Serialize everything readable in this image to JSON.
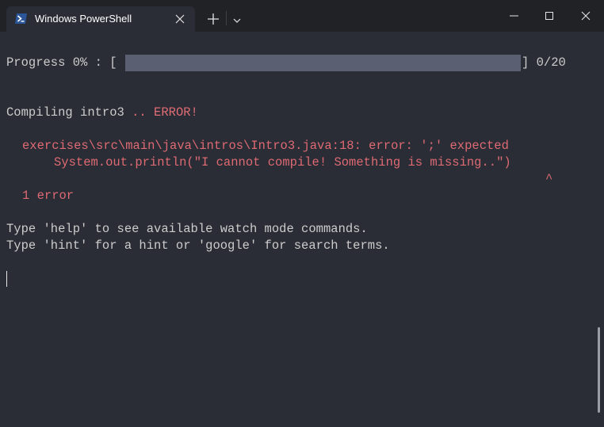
{
  "titlebar": {
    "tab_title": "Windows PowerShell",
    "tab_icon": "powershell-icon",
    "close_tab_icon": "close-icon",
    "new_tab_icon": "plus-icon",
    "dropdown_icon": "chevron-down-icon",
    "minimize_icon": "minimize-icon",
    "maximize_icon": "maximize-icon",
    "close_window_icon": "close-icon"
  },
  "terminal": {
    "progress_label": "Progress 0% : [",
    "progress_end": "] 0/20",
    "progress_fraction": 0,
    "compiling_text": "Compiling intro3",
    "compiling_dots": " .. ",
    "compiling_status": "ERROR!",
    "error_path_line": "exercises\\src\\main\\java\\intros\\Intro3.java:18: error: ';' expected",
    "error_code_line": "System.out.println(\"I cannot compile! Something is missing..\")",
    "error_caret": "^",
    "error_count": "1 error",
    "help_line": "Type 'help' to see available watch mode commands.",
    "hint_line": "Type 'hint' for a hint or 'google' for search terms."
  },
  "colors": {
    "background": "#2a2d35",
    "titlebar": "#202226",
    "error": "#e06c75",
    "text": "#cccccc",
    "progress_bar": "#5a6072",
    "powershell_icon": "#2b579a"
  }
}
